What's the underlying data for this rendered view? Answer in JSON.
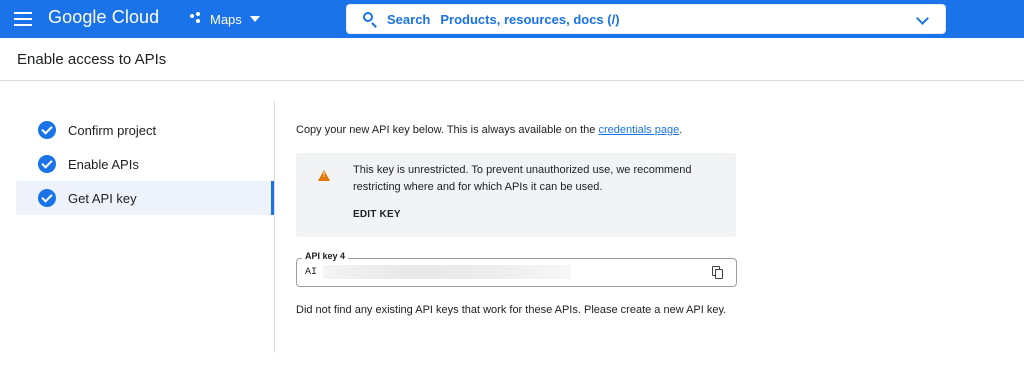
{
  "header": {
    "logo_text": "Google Cloud",
    "project_name": "Maps",
    "search_label": "Search",
    "search_placeholder": "Products, resources, docs (/)",
    "brand_color": "#1a73e8",
    "icons": [
      "menu-icon",
      "project-icon",
      "search-icon",
      "chevron-down-icon"
    ]
  },
  "page": {
    "title": "Enable access to APIs"
  },
  "stepper": {
    "steps": [
      {
        "label": "Confirm project",
        "status": "complete",
        "icon": "check-circle-icon"
      },
      {
        "label": "Enable APIs",
        "status": "complete",
        "icon": "check-circle-icon"
      },
      {
        "label": "Get API key",
        "status": "complete",
        "active": true,
        "icon": "check-circle-icon"
      }
    ]
  },
  "content": {
    "intro_text": "Copy your new API key below. This is always available on the ",
    "intro_link": "credentials page",
    "intro_end": ".",
    "warning": {
      "icon": "warning-icon",
      "text": "This key is unrestricted. To prevent unauthorized use, we recommend restricting where and for which APIs it can be used.",
      "action": "EDIT KEY",
      "color": "#e37400"
    },
    "api_key": {
      "label": "API key 4",
      "value_prefix": "AI",
      "copy_icon": "copy-icon"
    },
    "note": "Did not find any existing API keys that work for these APIs. Please create a new API key."
  }
}
